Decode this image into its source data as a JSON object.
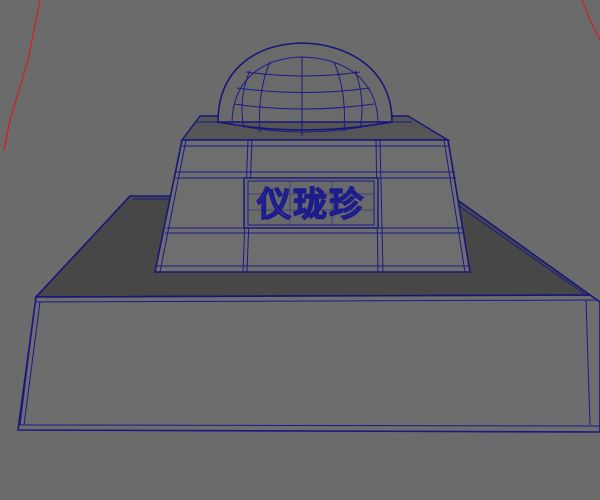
{
  "scene": {
    "plaque_text": "仪珑珍",
    "colors": {
      "background": "#6b6b6b",
      "wireframe": "#1a1a8a",
      "guide": "#d42020",
      "top_face": "#474747",
      "front_face": "#6d6d6d",
      "side_face": "#686868",
      "tower_face": "#6e6e6e",
      "dome": "#6a6a6a"
    }
  }
}
